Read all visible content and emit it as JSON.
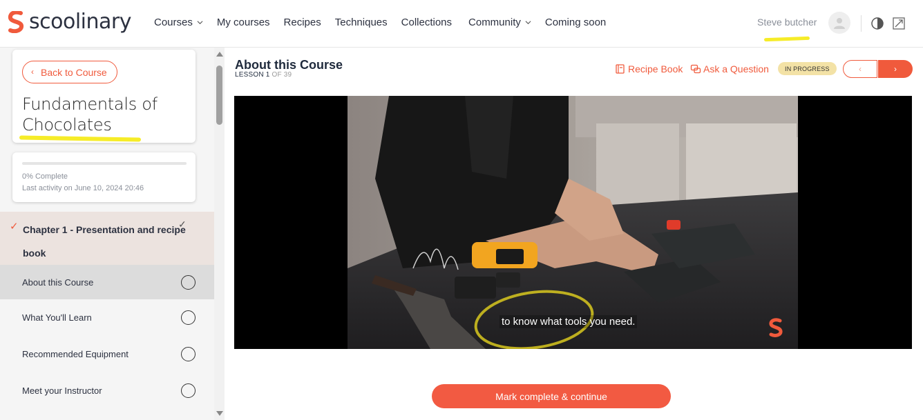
{
  "brand": {
    "name": "scoolinary",
    "accent": "#f05a3c"
  },
  "nav": {
    "items": [
      {
        "label": "Courses",
        "dropdown": true
      },
      {
        "label": "My courses",
        "dropdown": false
      },
      {
        "label": "Recipes",
        "dropdown": false
      },
      {
        "label": "Techniques",
        "dropdown": false
      },
      {
        "label": "Collections",
        "dropdown": false
      },
      {
        "label": "Community",
        "dropdown": true
      },
      {
        "label": "Coming soon",
        "dropdown": false
      }
    ]
  },
  "user": {
    "name": "Steve butcher",
    "avatar_icon": "user-icon"
  },
  "toolbar": {
    "icons": [
      "contrast-icon",
      "expand-icon"
    ]
  },
  "sidebar": {
    "back_label": "Back to Course",
    "course_title": "Fundamentals of Chocolates",
    "progress": {
      "percent": 0,
      "label": "0% Complete",
      "last_activity": "Last activity on June 10, 2024 20:46"
    },
    "chapter": {
      "label": "Chapter 1 - Presentation and recipe book",
      "completed": true
    },
    "lessons": [
      {
        "label": "About this Course",
        "active": true
      },
      {
        "label": "What You'll Learn",
        "active": false
      },
      {
        "label": "Recommended Equipment",
        "active": false
      },
      {
        "label": "Meet your Instructor",
        "active": false
      }
    ]
  },
  "lesson": {
    "title": "About this Course",
    "counter_prefix": "LESSON 1",
    "counter_suffix": "OF 39",
    "recipe_book_label": "Recipe Book",
    "ask_question_label": "Ask a Question",
    "status": "IN PROGRESS",
    "prev_glyph": "‹",
    "next_glyph": "›"
  },
  "video": {
    "caption": "to know what tools you need."
  },
  "footer": {
    "mark_complete_label": "Mark complete & continue"
  },
  "colors": {
    "accent": "#f05a3c",
    "badge_bg": "#f3e2a6",
    "highlight": "#f6ec28"
  }
}
